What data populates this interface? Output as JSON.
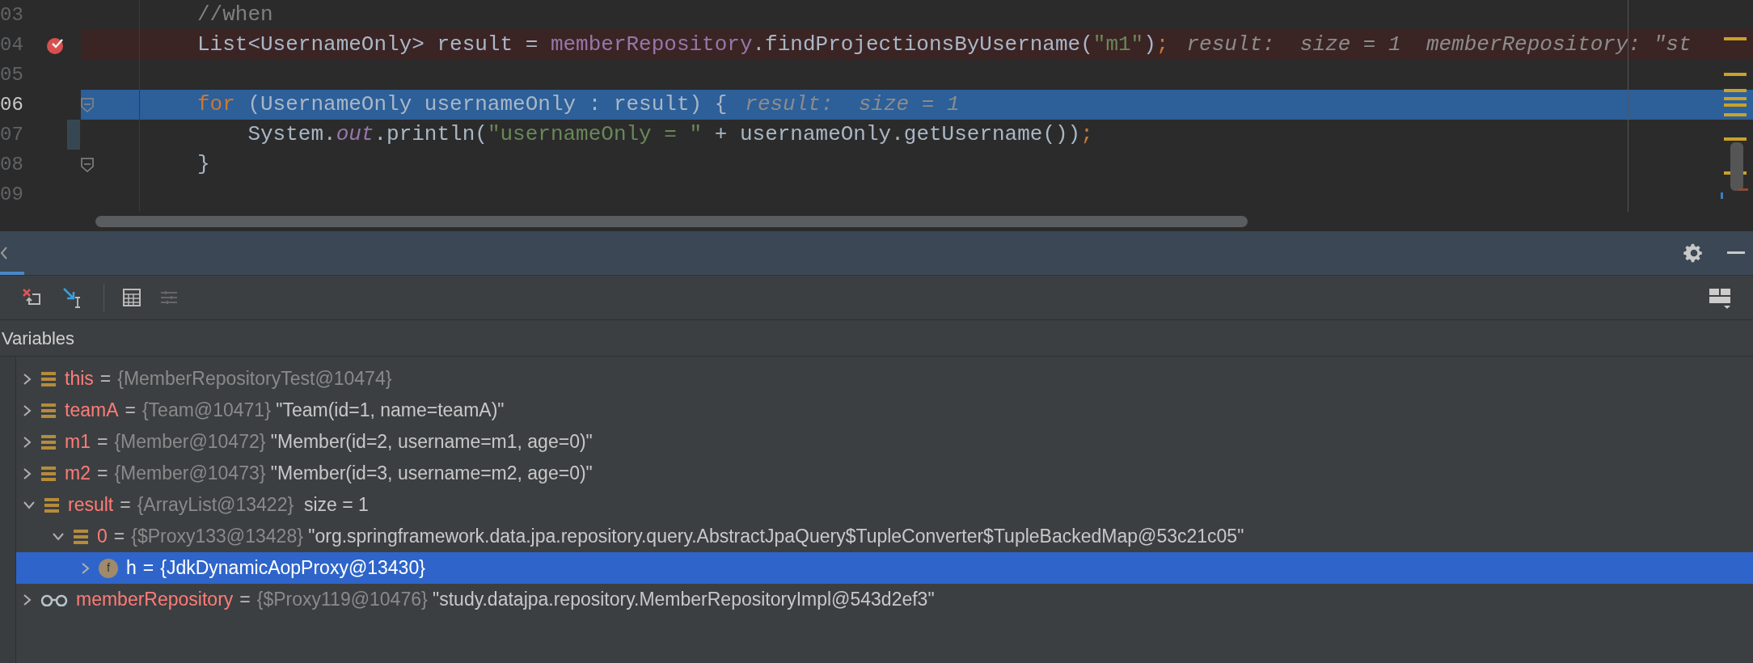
{
  "editor": {
    "lines": [
      {
        "number": "03",
        "kind": "plain",
        "tokens": [
          {
            "text": "//when",
            "kind": "comment"
          }
        ]
      },
      {
        "number": "04",
        "kind": "breakpoint",
        "tokens": [
          {
            "text": "List<UsernameOnly> result = ",
            "kind": "plain"
          },
          {
            "text": "memberRepository",
            "kind": "field"
          },
          {
            "text": ".findProjectionsByUsername(",
            "kind": "plain"
          },
          {
            "text": "\"m1\"",
            "kind": "string"
          },
          {
            "text": ")",
            "kind": "plain"
          },
          {
            "text": ";",
            "kind": "punct"
          }
        ],
        "hint": "result:  size = 1  memberRepository: \"st"
      },
      {
        "number": "05",
        "kind": "plain"
      },
      {
        "number": "06",
        "kind": "current",
        "tokens": [
          {
            "text": "for",
            "kind": "keyword"
          },
          {
            "text": " (UsernameOnly usernameOnly : result) {",
            "kind": "plain"
          }
        ],
        "hint": "result:  size = 1"
      },
      {
        "number": "07",
        "kind": "change",
        "tokens": [
          {
            "text": "    System.",
            "kind": "plain"
          },
          {
            "text": "out",
            "kind": "static"
          },
          {
            "text": ".println(",
            "kind": "plain"
          },
          {
            "text": "\"usernameOnly = \"",
            "kind": "string"
          },
          {
            "text": " + usernameOnly.getUsername())",
            "kind": "plain"
          },
          {
            "text": ";",
            "kind": "punct"
          }
        ]
      },
      {
        "number": "08",
        "kind": "fold",
        "tokens": [
          {
            "text": "}",
            "kind": "plain"
          }
        ]
      },
      {
        "number": "09",
        "kind": "plain"
      }
    ]
  },
  "panel": {
    "section_title": "Variables",
    "variables": [
      {
        "name": "this",
        "operator": "=",
        "ref": "{MemberRepositoryTest@10474}",
        "kind": "list",
        "expanded": false,
        "selected": false
      },
      {
        "name": "teamA",
        "operator": "=",
        "ref": "{Team@10471}",
        "value": "\"Team(id=1, name=teamA)\"",
        "kind": "list",
        "expanded": false,
        "selected": false
      },
      {
        "name": "m1",
        "operator": "=",
        "ref": "{Member@10472}",
        "value": "\"Member(id=2, username=m1, age=0)\"",
        "kind": "list",
        "expanded": false,
        "selected": false
      },
      {
        "name": "m2",
        "operator": "=",
        "ref": "{Member@10473}",
        "value": "\"Member(id=3, username=m2, age=0)\"",
        "kind": "list",
        "expanded": false,
        "selected": false
      },
      {
        "name": "result",
        "operator": "=",
        "ref": "{ArrayList@13422}",
        "value": " size = 1",
        "kind": "list",
        "expanded": true,
        "selected": false,
        "children": [
          {
            "name": "0",
            "operator": "=",
            "ref": "{$Proxy133@13428}",
            "value": "\"org.springframework.data.jpa.repository.query.AbstractJpaQuery$TupleConverter$TupleBackedMap@53c21c05\"",
            "kind": "list",
            "expanded": true,
            "selected": false,
            "children": [
              {
                "name": "h",
                "operator": "=",
                "ref": "{JdkDynamicAopProxy@13430}",
                "kind": "field",
                "icon_label": "f",
                "expanded": false,
                "selected": true
              }
            ]
          }
        ]
      },
      {
        "name": "memberRepository",
        "operator": "=",
        "ref": "{$Proxy119@10476}",
        "value": "\"study.datajpa.repository.MemberRepositoryImpl@543d2ef3\"",
        "kind": "glasses",
        "expanded": false,
        "selected": false
      }
    ]
  }
}
